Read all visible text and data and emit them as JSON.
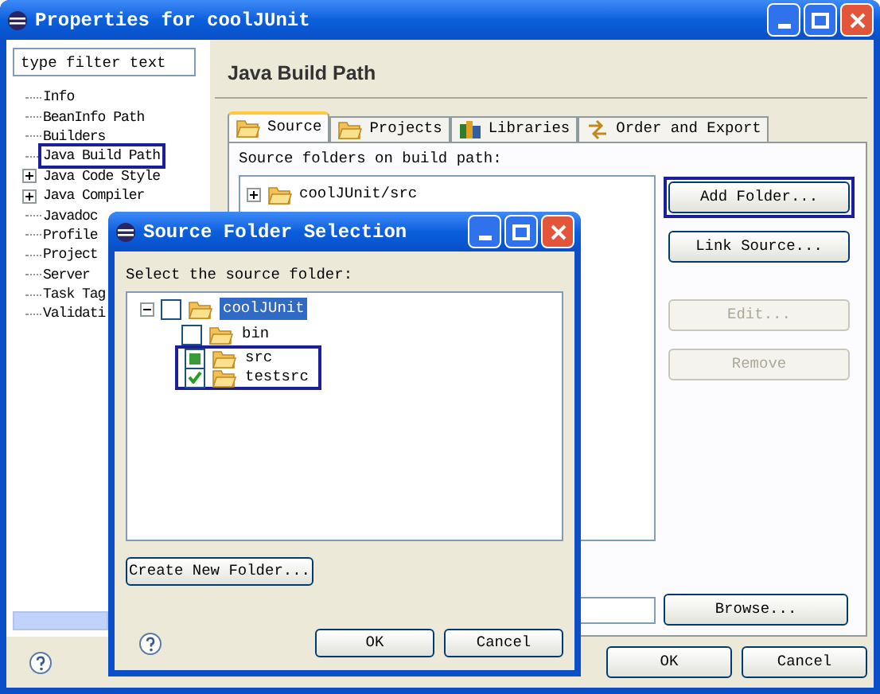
{
  "window": {
    "title": "Properties for coolJUnit"
  },
  "filter": {
    "placeholder": "type filter text"
  },
  "nav_tree": [
    {
      "label": "Info",
      "expandable": false,
      "highlighted": false
    },
    {
      "label": "BeanInfo Path",
      "expandable": false,
      "highlighted": false
    },
    {
      "label": "Builders",
      "expandable": false,
      "highlighted": false
    },
    {
      "label": "Java Build Path",
      "expandable": false,
      "highlighted": true
    },
    {
      "label": "Java Code Style",
      "expandable": true,
      "highlighted": false
    },
    {
      "label": "Java Compiler",
      "expandable": true,
      "highlighted": false
    },
    {
      "label": "Javadoc",
      "expandable": false,
      "highlighted": false
    },
    {
      "label": "Profile",
      "expandable": false,
      "highlighted": false
    },
    {
      "label": "Project",
      "expandable": false,
      "highlighted": false
    },
    {
      "label": "Server",
      "expandable": false,
      "highlighted": false
    },
    {
      "label": "Task Tag",
      "expandable": false,
      "highlighted": false
    },
    {
      "label": "Validati",
      "expandable": false,
      "highlighted": false
    }
  ],
  "page": {
    "title": "Java Build Path",
    "tabs": [
      {
        "label": "Source",
        "selected": true
      },
      {
        "label": "Projects",
        "selected": false
      },
      {
        "label": "Libraries",
        "selected": false
      },
      {
        "label": "Order and Export",
        "selected": false
      }
    ],
    "list_label": "Source folders on build path:",
    "source_folders": [
      {
        "label": "coolJUnit/src",
        "expanded": false
      }
    ],
    "side_buttons": [
      {
        "label": "Add Folder...",
        "disabled": false,
        "highlighted": true
      },
      {
        "label": "Link Source...",
        "disabled": false,
        "highlighted": false
      },
      {
        "label": "Edit...",
        "disabled": true,
        "highlighted": false
      },
      {
        "label": "Remove",
        "disabled": true,
        "highlighted": false
      }
    ],
    "browse_button": "Browse..."
  },
  "buttons": [
    "OK",
    "Cancel"
  ],
  "dialog": {
    "title": "Source Folder Selection",
    "label": "Select the source folder:",
    "tree": [
      {
        "label": "coolJUnit",
        "checked": false,
        "grayed": false,
        "selected": true,
        "expanded": true,
        "highlighted": false,
        "children": [
          {
            "label": "bin",
            "checked": false,
            "grayed": false,
            "selected": false,
            "highlighted": false
          },
          {
            "label": "src",
            "checked": true,
            "grayed": true,
            "selected": false,
            "highlighted": true
          },
          {
            "label": "testsrc",
            "checked": true,
            "grayed": false,
            "selected": false,
            "highlighted": true
          }
        ]
      }
    ],
    "create_button": "Create New Folder...",
    "buttons": [
      "OK",
      "Cancel"
    ]
  }
}
